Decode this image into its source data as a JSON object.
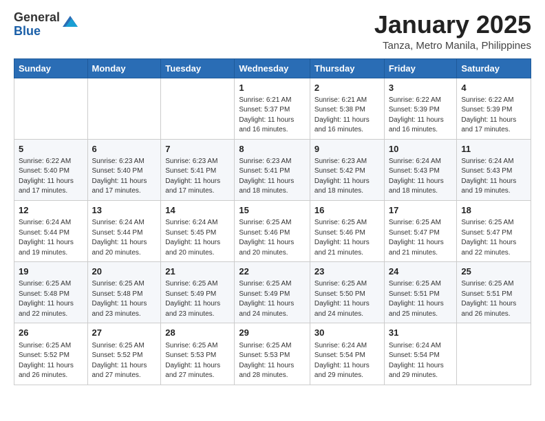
{
  "logo": {
    "general": "General",
    "blue": "Blue"
  },
  "title": "January 2025",
  "location": "Tanza, Metro Manila, Philippines",
  "days_of_week": [
    "Sunday",
    "Monday",
    "Tuesday",
    "Wednesday",
    "Thursday",
    "Friday",
    "Saturday"
  ],
  "weeks": [
    [
      {
        "day": "",
        "info": ""
      },
      {
        "day": "",
        "info": ""
      },
      {
        "day": "",
        "info": ""
      },
      {
        "day": "1",
        "info": "Sunrise: 6:21 AM\nSunset: 5:37 PM\nDaylight: 11 hours and 16 minutes."
      },
      {
        "day": "2",
        "info": "Sunrise: 6:21 AM\nSunset: 5:38 PM\nDaylight: 11 hours and 16 minutes."
      },
      {
        "day": "3",
        "info": "Sunrise: 6:22 AM\nSunset: 5:39 PM\nDaylight: 11 hours and 16 minutes."
      },
      {
        "day": "4",
        "info": "Sunrise: 6:22 AM\nSunset: 5:39 PM\nDaylight: 11 hours and 17 minutes."
      }
    ],
    [
      {
        "day": "5",
        "info": "Sunrise: 6:22 AM\nSunset: 5:40 PM\nDaylight: 11 hours and 17 minutes."
      },
      {
        "day": "6",
        "info": "Sunrise: 6:23 AM\nSunset: 5:40 PM\nDaylight: 11 hours and 17 minutes."
      },
      {
        "day": "7",
        "info": "Sunrise: 6:23 AM\nSunset: 5:41 PM\nDaylight: 11 hours and 17 minutes."
      },
      {
        "day": "8",
        "info": "Sunrise: 6:23 AM\nSunset: 5:41 PM\nDaylight: 11 hours and 18 minutes."
      },
      {
        "day": "9",
        "info": "Sunrise: 6:23 AM\nSunset: 5:42 PM\nDaylight: 11 hours and 18 minutes."
      },
      {
        "day": "10",
        "info": "Sunrise: 6:24 AM\nSunset: 5:43 PM\nDaylight: 11 hours and 18 minutes."
      },
      {
        "day": "11",
        "info": "Sunrise: 6:24 AM\nSunset: 5:43 PM\nDaylight: 11 hours and 19 minutes."
      }
    ],
    [
      {
        "day": "12",
        "info": "Sunrise: 6:24 AM\nSunset: 5:44 PM\nDaylight: 11 hours and 19 minutes."
      },
      {
        "day": "13",
        "info": "Sunrise: 6:24 AM\nSunset: 5:44 PM\nDaylight: 11 hours and 20 minutes."
      },
      {
        "day": "14",
        "info": "Sunrise: 6:24 AM\nSunset: 5:45 PM\nDaylight: 11 hours and 20 minutes."
      },
      {
        "day": "15",
        "info": "Sunrise: 6:25 AM\nSunset: 5:46 PM\nDaylight: 11 hours and 20 minutes."
      },
      {
        "day": "16",
        "info": "Sunrise: 6:25 AM\nSunset: 5:46 PM\nDaylight: 11 hours and 21 minutes."
      },
      {
        "day": "17",
        "info": "Sunrise: 6:25 AM\nSunset: 5:47 PM\nDaylight: 11 hours and 21 minutes."
      },
      {
        "day": "18",
        "info": "Sunrise: 6:25 AM\nSunset: 5:47 PM\nDaylight: 11 hours and 22 minutes."
      }
    ],
    [
      {
        "day": "19",
        "info": "Sunrise: 6:25 AM\nSunset: 5:48 PM\nDaylight: 11 hours and 22 minutes."
      },
      {
        "day": "20",
        "info": "Sunrise: 6:25 AM\nSunset: 5:48 PM\nDaylight: 11 hours and 23 minutes."
      },
      {
        "day": "21",
        "info": "Sunrise: 6:25 AM\nSunset: 5:49 PM\nDaylight: 11 hours and 23 minutes."
      },
      {
        "day": "22",
        "info": "Sunrise: 6:25 AM\nSunset: 5:49 PM\nDaylight: 11 hours and 24 minutes."
      },
      {
        "day": "23",
        "info": "Sunrise: 6:25 AM\nSunset: 5:50 PM\nDaylight: 11 hours and 24 minutes."
      },
      {
        "day": "24",
        "info": "Sunrise: 6:25 AM\nSunset: 5:51 PM\nDaylight: 11 hours and 25 minutes."
      },
      {
        "day": "25",
        "info": "Sunrise: 6:25 AM\nSunset: 5:51 PM\nDaylight: 11 hours and 26 minutes."
      }
    ],
    [
      {
        "day": "26",
        "info": "Sunrise: 6:25 AM\nSunset: 5:52 PM\nDaylight: 11 hours and 26 minutes."
      },
      {
        "day": "27",
        "info": "Sunrise: 6:25 AM\nSunset: 5:52 PM\nDaylight: 11 hours and 27 minutes."
      },
      {
        "day": "28",
        "info": "Sunrise: 6:25 AM\nSunset: 5:53 PM\nDaylight: 11 hours and 27 minutes."
      },
      {
        "day": "29",
        "info": "Sunrise: 6:25 AM\nSunset: 5:53 PM\nDaylight: 11 hours and 28 minutes."
      },
      {
        "day": "30",
        "info": "Sunrise: 6:24 AM\nSunset: 5:54 PM\nDaylight: 11 hours and 29 minutes."
      },
      {
        "day": "31",
        "info": "Sunrise: 6:24 AM\nSunset: 5:54 PM\nDaylight: 11 hours and 29 minutes."
      },
      {
        "day": "",
        "info": ""
      }
    ]
  ]
}
